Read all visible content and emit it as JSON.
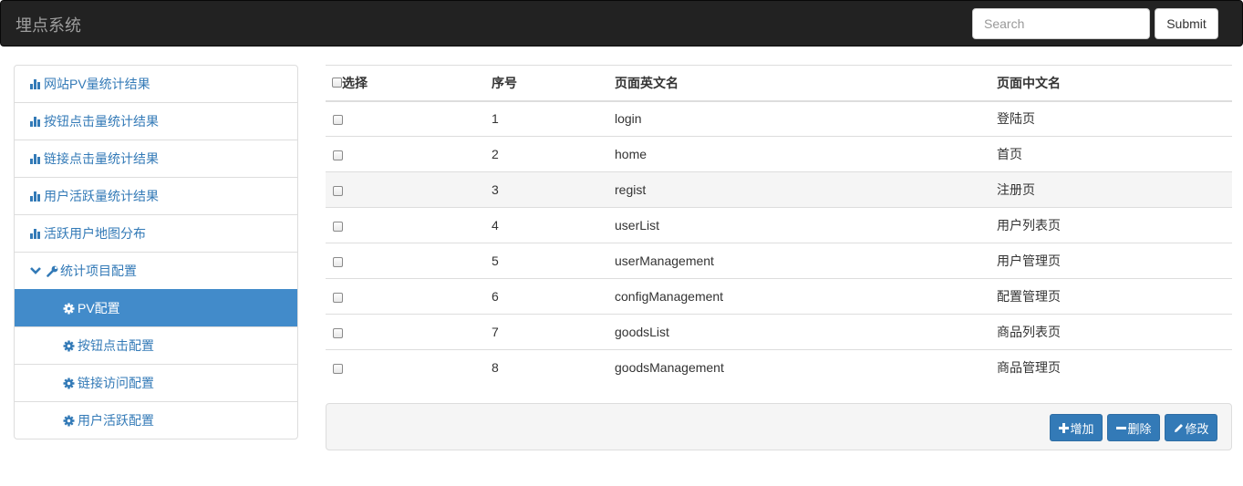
{
  "navbar": {
    "brand": "埋点系统",
    "search_placeholder": "Search",
    "submit_label": "Submit"
  },
  "sidebar": {
    "items": [
      {
        "label": "网站PV量统计结果",
        "icon": "bar-chart-icon"
      },
      {
        "label": "按钮点击量统计结果",
        "icon": "bar-chart-icon"
      },
      {
        "label": "链接点击量统计结果",
        "icon": "bar-chart-icon"
      },
      {
        "label": "用户活跃量统计结果",
        "icon": "bar-chart-icon"
      },
      {
        "label": "活跃用户地图分布",
        "icon": "bar-chart-icon"
      },
      {
        "label": "统计项目配置",
        "icon": "wrench-icon",
        "expanded": true
      },
      {
        "label": "PV配置",
        "icon": "gear-icon",
        "active": true
      },
      {
        "label": "按钮点击配置",
        "icon": "gear-icon"
      },
      {
        "label": "链接访问配置",
        "icon": "gear-icon"
      },
      {
        "label": "用户活跃配置",
        "icon": "gear-icon"
      }
    ]
  },
  "table": {
    "headers": [
      "选择",
      "序号",
      "页面英文名",
      "页面中文名"
    ],
    "rows": [
      {
        "no": "1",
        "en": "login",
        "zh": "登陆页"
      },
      {
        "no": "2",
        "en": "home",
        "zh": "首页"
      },
      {
        "no": "3",
        "en": "regist",
        "zh": "注册页"
      },
      {
        "no": "4",
        "en": "userList",
        "zh": "用户列表页"
      },
      {
        "no": "5",
        "en": "userManagement",
        "zh": "用户管理页"
      },
      {
        "no": "6",
        "en": "configManagement",
        "zh": "配置管理页"
      },
      {
        "no": "7",
        "en": "goodsList",
        "zh": "商品列表页"
      },
      {
        "no": "8",
        "en": "goodsManagement",
        "zh": "商品管理页"
      }
    ]
  },
  "actions": {
    "add_label": "增加",
    "delete_label": "删除",
    "edit_label": "修改"
  },
  "colors": {
    "navbar_bg": "#222222",
    "link": "#337ab7",
    "active_bg": "#428bca",
    "primary_button": "#337ab7"
  }
}
